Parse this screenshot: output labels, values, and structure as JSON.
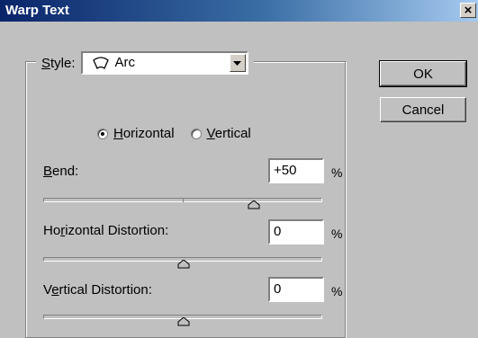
{
  "window": {
    "title": "Warp Text",
    "close_glyph": "×",
    "close_icon": "close-icon"
  },
  "style": {
    "label_prefix": "S",
    "label_rest": "tyle:",
    "value": "Arc",
    "value_icon": "arc-warp-icon"
  },
  "orientation": {
    "horizontal": {
      "u": "H",
      "rest": "orizontal",
      "checked": true
    },
    "vertical": {
      "u": "V",
      "rest": "ertical",
      "checked": false
    }
  },
  "bend": {
    "label_u": "B",
    "label_rest": "end:",
    "value": "+50",
    "unit": "%",
    "slider_percent": 50
  },
  "horizontal_distortion": {
    "label_pre": "Ho",
    "label_u": "r",
    "label_rest": "izontal Distortion:",
    "value": "0",
    "unit": "%",
    "slider_percent": 0
  },
  "vertical_distortion": {
    "label_pre": "V",
    "label_u": "e",
    "label_rest": "rtical Distortion:",
    "value": "0",
    "unit": "%",
    "slider_percent": 0
  },
  "buttons": {
    "ok": "OK",
    "cancel": "Cancel"
  }
}
